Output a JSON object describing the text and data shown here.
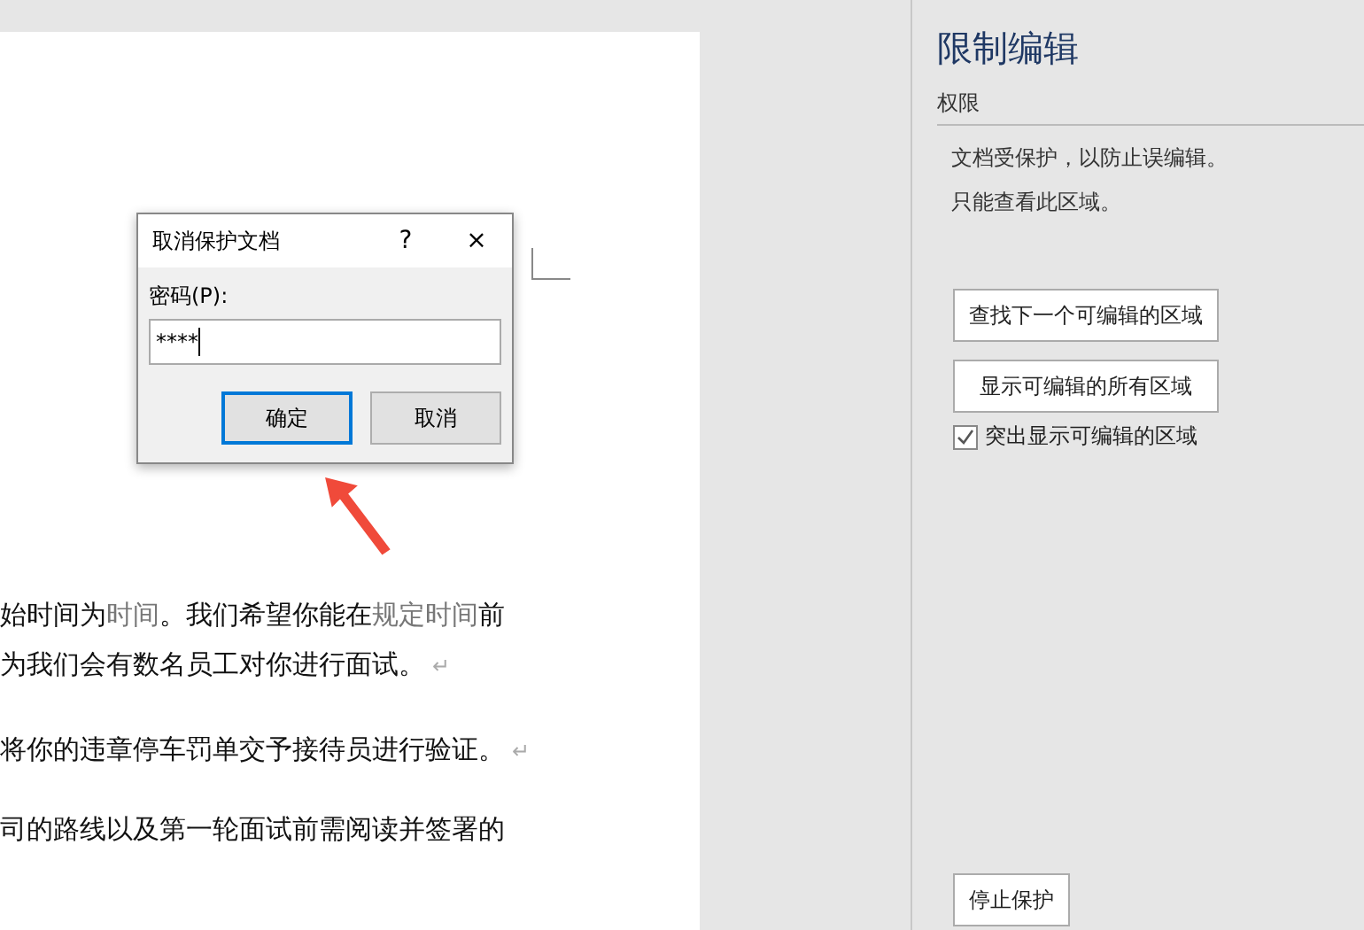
{
  "document": {
    "lines": [
      {
        "segments": [
          {
            "kind": "plain",
            "text": "始时间为"
          },
          {
            "kind": "field",
            "text": "时间"
          },
          {
            "kind": "plain",
            "text": "。我们希望你能在"
          },
          {
            "kind": "field",
            "text": "规定时间"
          },
          {
            "kind": "plain",
            "text": "前"
          }
        ]
      },
      {
        "segments": [
          {
            "kind": "plain",
            "text": "为我们会有数名员工对你进行面试。"
          },
          {
            "kind": "mark",
            "text": "↵"
          }
        ]
      },
      {
        "segments": [
          {
            "kind": "plain",
            "text": "将你的违章停车罚单交予接待员进行验证。"
          },
          {
            "kind": "mark",
            "text": "↵"
          }
        ]
      },
      {
        "segments": [
          {
            "kind": "plain",
            "text": "司的路线以及第一轮面试前需阅读并签署的"
          }
        ]
      }
    ]
  },
  "dialog": {
    "title": "取消保护文档",
    "help": "?",
    "close": "×",
    "field_label": "密码(P):",
    "value": "****",
    "buttons": [
      {
        "label": "确定",
        "selected": true
      },
      {
        "label": "取消",
        "selected": false
      }
    ]
  },
  "pane": {
    "title": "限制编辑",
    "section": "权限",
    "messages": [
      "文档受保护，以防止误编辑。",
      "只能查看此区域。"
    ],
    "buttons": [
      "查找下一个可编辑的区域",
      "显示可编辑的所有区域"
    ],
    "checkbox": {
      "label": "突出显示可编辑的区域",
      "checked": true
    },
    "stop_button": "停止保护"
  }
}
